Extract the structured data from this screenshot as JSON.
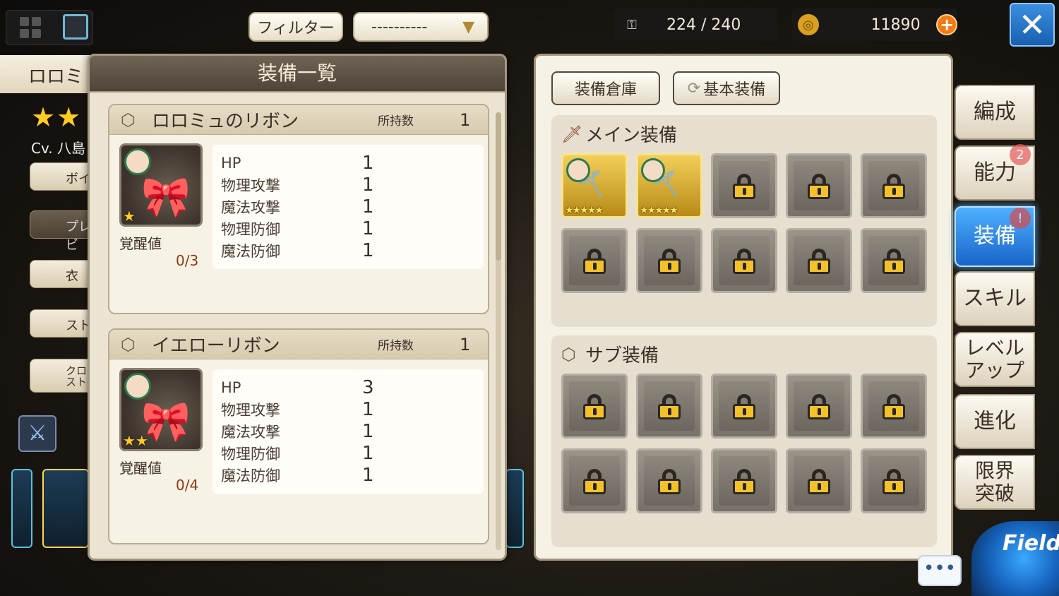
{
  "topbar": {
    "filter_label": "フィルター",
    "dropdown_value": "----------",
    "stamina": "224 / 240",
    "coins": "11890"
  },
  "background_panel": {
    "char_name": "ロロミ",
    "stars": "★★",
    "cv": "Cv. 八島",
    "tabs": [
      "ボイ",
      "プレビ",
      "衣",
      "スト-",
      "クロス\nスト-"
    ]
  },
  "modal": {
    "title": "装備一覧",
    "items": [
      {
        "name": "ロロミュのリボン",
        "owned_label": "所持数",
        "owned": "1",
        "awaken_label": "覚醒値",
        "awaken": "0/3",
        "stars": "★",
        "stats": [
          {
            "name": "HP",
            "value": "1"
          },
          {
            "name": "物理攻撃",
            "value": "1"
          },
          {
            "name": "魔法攻撃",
            "value": "1"
          },
          {
            "name": "物理防御",
            "value": "1"
          },
          {
            "name": "魔法防御",
            "value": "1"
          }
        ]
      },
      {
        "name": "イエローリボン",
        "owned_label": "所持数",
        "owned": "1",
        "awaken_label": "覚醒値",
        "awaken": "0/4",
        "stars": "★★",
        "stats": [
          {
            "name": "HP",
            "value": "3"
          },
          {
            "name": "物理攻撃",
            "value": "1"
          },
          {
            "name": "魔法攻撃",
            "value": "1"
          },
          {
            "name": "物理防御",
            "value": "1"
          },
          {
            "name": "魔法防御",
            "value": "1"
          }
        ]
      }
    ]
  },
  "equip_panel": {
    "storage_button": "装備倉庫",
    "basic_button": "基本装備",
    "main_title": "メイン装備",
    "sub_title": "サブ装備",
    "slot_stars": "★★★★★"
  },
  "side_menu": {
    "items": [
      "編成",
      "能力",
      "装備",
      "スキル",
      "レベル\nアップ",
      "進化",
      "限界\n突破"
    ],
    "ability_badge": "2",
    "equip_badge": "!"
  },
  "field_button": "Field",
  "chat_button": "•••",
  "colors": {
    "accent": "#1865c8",
    "lock": "#f3c12a",
    "plus": "#f27b14"
  }
}
